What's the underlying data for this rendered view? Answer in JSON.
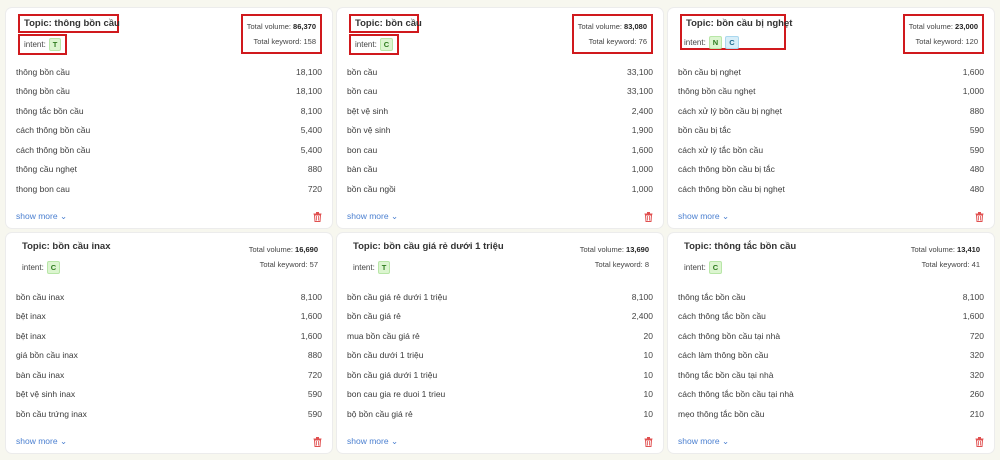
{
  "colors": {
    "highlight": "#d0191d",
    "link": "#4a7fd0",
    "trash": "#e05050"
  },
  "labels": {
    "intent": "intent:",
    "total_volume": "Total volume:",
    "total_keyword": "Total keyword:",
    "show_more": "show more",
    "chevron": "⌄"
  },
  "cards": [
    {
      "topic": "Topic: thông bồn cầu",
      "intents": [
        "T"
      ],
      "total_volume": "86,370",
      "total_keyword": "158",
      "rows": [
        {
          "kw": "thông bồn cầu",
          "vol": "18,100"
        },
        {
          "kw": "thông bồn cầu",
          "vol": "18,100"
        },
        {
          "kw": "thông tắc bồn cầu",
          "vol": "8,100"
        },
        {
          "kw": "cách thông bồn cầu",
          "vol": "5,400"
        },
        {
          "kw": "cách thông bồn cầu",
          "vol": "5,400"
        },
        {
          "kw": "thông cầu nghẹt",
          "vol": "880"
        },
        {
          "kw": "thong bon cau",
          "vol": "720"
        }
      ]
    },
    {
      "topic": "Topic: bồn cầu",
      "intents": [
        "C"
      ],
      "total_volume": "83,080",
      "total_keyword": "76",
      "rows": [
        {
          "kw": "bồn cầu",
          "vol": "33,100"
        },
        {
          "kw": "bồn cau",
          "vol": "33,100"
        },
        {
          "kw": "bệt vệ sinh",
          "vol": "2,400"
        },
        {
          "kw": "bồn vệ sinh",
          "vol": "1,900"
        },
        {
          "kw": "bon cau",
          "vol": "1,600"
        },
        {
          "kw": "bàn cầu",
          "vol": "1,000"
        },
        {
          "kw": "bồn cầu ngồi",
          "vol": "1,000"
        }
      ]
    },
    {
      "topic": "Topic: bồn cầu bị nghẹt",
      "intents": [
        "N",
        "C"
      ],
      "total_volume": "23,000",
      "total_keyword": "120",
      "rows": [
        {
          "kw": "bồn cầu bị nghẹt",
          "vol": "1,600"
        },
        {
          "kw": "thông bồn cầu nghẹt",
          "vol": "1,000"
        },
        {
          "kw": "cách xử lý bồn cầu bị nghẹt",
          "vol": "880"
        },
        {
          "kw": "bồn cầu bị tắc",
          "vol": "590"
        },
        {
          "kw": "cách xử lý tắc bồn cầu",
          "vol": "590"
        },
        {
          "kw": "cách thông bồn cầu bị tắc",
          "vol": "480"
        },
        {
          "kw": "cách thông bồn cầu bị nghẹt",
          "vol": "480"
        }
      ]
    },
    {
      "topic": "Topic: bồn cầu inax",
      "intents": [
        "C"
      ],
      "total_volume": "16,690",
      "total_keyword": "57",
      "rows": [
        {
          "kw": "bồn cầu inax",
          "vol": "8,100"
        },
        {
          "kw": "bệt inax",
          "vol": "1,600"
        },
        {
          "kw": "bệt inax",
          "vol": "1,600"
        },
        {
          "kw": "giá bồn cầu inax",
          "vol": "880"
        },
        {
          "kw": "bàn cầu inax",
          "vol": "720"
        },
        {
          "kw": "bệt vệ sinh inax",
          "vol": "590"
        },
        {
          "kw": "bồn cầu trứng inax",
          "vol": "590"
        }
      ]
    },
    {
      "topic": "Topic: bồn cầu giá rẻ dưới 1 triệu",
      "intents": [
        "T"
      ],
      "total_volume": "13,690",
      "total_keyword": "8",
      "rows": [
        {
          "kw": "bồn cầu giá rẻ dưới 1 triệu",
          "vol": "8,100"
        },
        {
          "kw": "bồn cầu giá rẻ",
          "vol": "2,400"
        },
        {
          "kw": "mua bồn cầu giá rẻ",
          "vol": "20"
        },
        {
          "kw": "bồn cầu dưới 1 triệu",
          "vol": "10"
        },
        {
          "kw": "bồn cầu giá dưới 1 triệu",
          "vol": "10"
        },
        {
          "kw": "bon cau gia re duoi 1 trieu",
          "vol": "10"
        },
        {
          "kw": "bộ bồn cầu giá rẻ",
          "vol": "10"
        }
      ]
    },
    {
      "topic": "Topic: thông tắc bồn cầu",
      "intents": [
        "C"
      ],
      "total_volume": "13,410",
      "total_keyword": "41",
      "rows": [
        {
          "kw": "thông tắc bồn cầu",
          "vol": "8,100"
        },
        {
          "kw": "cách thông tắc bồn cầu",
          "vol": "1,600"
        },
        {
          "kw": "cách thông bồn cầu tại nhà",
          "vol": "720"
        },
        {
          "kw": "cách làm thông bồn cầu",
          "vol": "320"
        },
        {
          "kw": "thông tắc bồn cầu tại nhà",
          "vol": "320"
        },
        {
          "kw": "cách thông tắc bồn cầu tại nhà",
          "vol": "260"
        },
        {
          "kw": "mẹo thông tắc bồn cầu",
          "vol": "210"
        }
      ]
    }
  ]
}
